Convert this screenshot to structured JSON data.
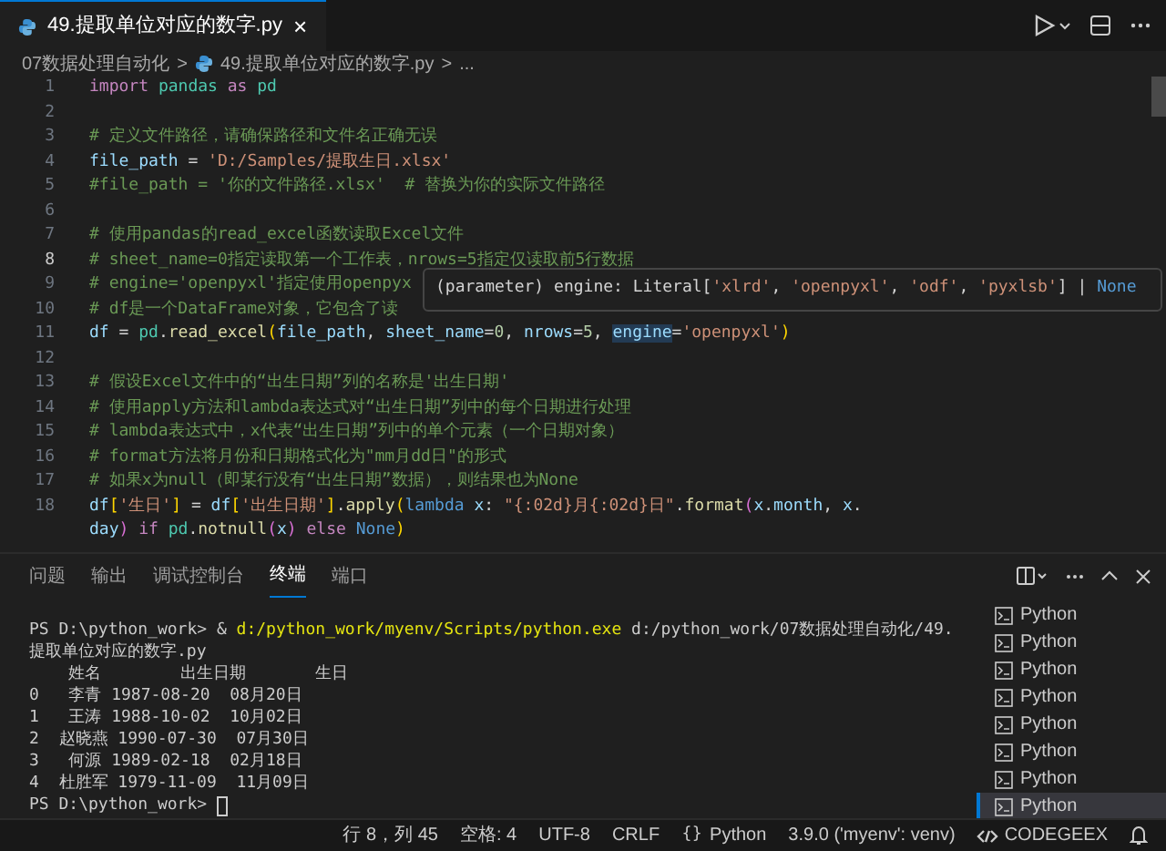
{
  "tab": {
    "label": "49.提取单位对应的数字.py",
    "close": "×",
    "selected": true
  },
  "breadcrumbs": [
    {
      "kind": "folder",
      "text": "07数据处理自动化"
    },
    {
      "kind": "sep",
      "text": ">"
    },
    {
      "kind": "file",
      "text": "49.提取单位对应的数字.py"
    },
    {
      "kind": "sep",
      "text": ">"
    },
    {
      "kind": "more",
      "text": "..."
    }
  ],
  "editor": {
    "rows": [
      {
        "number": "1",
        "active": false,
        "tokens": [
          {
            "kind": "kw",
            "text": "import "
          },
          {
            "kind": "mod",
            "text": "pandas "
          },
          {
            "kind": "kw",
            "text": "as "
          },
          {
            "kind": "mod",
            "text": "pd"
          }
        ]
      },
      {
        "number": "2",
        "active": false,
        "tokens": []
      },
      {
        "number": "3",
        "active": false,
        "tokens": [
          {
            "kind": "cmt",
            "text": "# 定义文件路径，请确保路径和文件名正确无误"
          }
        ]
      },
      {
        "number": "4",
        "active": false,
        "tokens": [
          {
            "kind": "var",
            "text": "file_path"
          },
          {
            "kind": "p",
            "text": " = "
          },
          {
            "kind": "str",
            "text": "'D:/Samples/提取生日.xlsx'"
          }
        ]
      },
      {
        "number": "5",
        "active": false,
        "tokens": [
          {
            "kind": "cmt",
            "text": "#file_path = '你的文件路径.xlsx'  # 替换为你的实际文件路径"
          }
        ]
      },
      {
        "number": "6",
        "active": false,
        "tokens": []
      },
      {
        "number": "7",
        "active": false,
        "tokens": [
          {
            "kind": "cmt",
            "text": "# 使用pandas的read_excel函数读取Excel文件"
          }
        ]
      },
      {
        "number": "8",
        "active": true,
        "tokens": [
          {
            "kind": "cmt",
            "text": "# sheet_name=0指定读取第一个工作表，nrows=5指定仅读取前5行数据"
          }
        ]
      },
      {
        "number": "9",
        "active": false,
        "tokens": [
          {
            "kind": "cmt",
            "text": "# engine='openpyxl'指定使用openpyx"
          }
        ]
      },
      {
        "number": "10",
        "active": false,
        "tokens": [
          {
            "kind": "cmt",
            "text": "# df是一个DataFrame对象，它包含了读"
          }
        ]
      },
      {
        "number": "11",
        "active": false,
        "tokens": [
          {
            "kind": "var",
            "text": "df"
          },
          {
            "kind": "p",
            "text": " = "
          },
          {
            "kind": "mod",
            "text": "pd"
          },
          {
            "kind": "p",
            "text": "."
          },
          {
            "kind": "fn",
            "text": "read_excel"
          },
          {
            "kind": "br",
            "text": "("
          },
          {
            "kind": "var",
            "text": "file_path"
          },
          {
            "kind": "p",
            "text": ", "
          },
          {
            "kind": "var",
            "text": "sheet_name"
          },
          {
            "kind": "p",
            "text": "="
          },
          {
            "kind": "num",
            "text": "0"
          },
          {
            "kind": "p",
            "text": ", "
          },
          {
            "kind": "var",
            "text": "nrows"
          },
          {
            "kind": "p",
            "text": "="
          },
          {
            "kind": "num",
            "text": "5"
          },
          {
            "kind": "p",
            "text": ", "
          },
          {
            "kind": "hl",
            "text": "engine"
          },
          {
            "kind": "p",
            "text": "="
          },
          {
            "kind": "str",
            "text": "'openpyxl'"
          },
          {
            "kind": "br",
            "text": ")"
          }
        ]
      },
      {
        "number": "12",
        "active": false,
        "tokens": []
      },
      {
        "number": "13",
        "active": false,
        "tokens": [
          {
            "kind": "cmt",
            "text": "# 假设Excel文件中的“出生日期”列的名称是'出生日期'"
          }
        ]
      },
      {
        "number": "14",
        "active": false,
        "tokens": [
          {
            "kind": "cmt",
            "text": "# 使用apply方法和lambda表达式对“出生日期”列中的每个日期进行处理"
          }
        ]
      },
      {
        "number": "15",
        "active": false,
        "tokens": [
          {
            "kind": "cmt",
            "text": "# lambda表达式中，x代表“出生日期”列中的单个元素（一个日期对象）"
          }
        ]
      },
      {
        "number": "16",
        "active": false,
        "tokens": [
          {
            "kind": "cmt",
            "text": "# format方法将月份和日期格式化为\"mm月dd日\"的形式"
          }
        ]
      },
      {
        "number": "17",
        "active": false,
        "tokens": [
          {
            "kind": "cmt",
            "text": "# 如果x为null（即某行没有“出生日期”数据），则结果也为None"
          }
        ]
      },
      {
        "number": "18",
        "active": false,
        "tokens": [
          {
            "kind": "var",
            "text": "df"
          },
          {
            "kind": "br",
            "text": "["
          },
          {
            "kind": "str",
            "text": "'生日'"
          },
          {
            "kind": "br",
            "text": "]"
          },
          {
            "kind": "p",
            "text": " = "
          },
          {
            "kind": "var",
            "text": "df"
          },
          {
            "kind": "br",
            "text": "["
          },
          {
            "kind": "str",
            "text": "'出生日期'"
          },
          {
            "kind": "br",
            "text": "]"
          },
          {
            "kind": "p",
            "text": "."
          },
          {
            "kind": "fn",
            "text": "apply"
          },
          {
            "kind": "br",
            "text": "("
          },
          {
            "kind": "stor",
            "text": "lambda "
          },
          {
            "kind": "var",
            "text": "x"
          },
          {
            "kind": "p",
            "text": ": "
          },
          {
            "kind": "str",
            "text": "\"{:02d}月{:02d}日\""
          },
          {
            "kind": "p",
            "text": "."
          },
          {
            "kind": "fn",
            "text": "format"
          },
          {
            "kind": "br2",
            "text": "("
          },
          {
            "kind": "var",
            "text": "x"
          },
          {
            "kind": "p",
            "text": "."
          },
          {
            "kind": "var",
            "text": "month"
          },
          {
            "kind": "p",
            "text": ", "
          },
          {
            "kind": "var",
            "text": "x"
          },
          {
            "kind": "p",
            "text": "."
          }
        ]
      },
      {
        "tokens": [
          {
            "kind": "var",
            "text": "day"
          },
          {
            "kind": "br2",
            "text": ") "
          },
          {
            "kind": "kw",
            "text": "if "
          },
          {
            "kind": "mod",
            "text": "pd"
          },
          {
            "kind": "p",
            "text": "."
          },
          {
            "kind": "fn",
            "text": "notnull"
          },
          {
            "kind": "br2",
            "text": "("
          },
          {
            "kind": "var",
            "text": "x"
          },
          {
            "kind": "br2",
            "text": ") "
          },
          {
            "kind": "kw",
            "text": "else "
          },
          {
            "kind": "stor",
            "text": "None"
          },
          {
            "kind": "br",
            "text": ")"
          }
        ]
      }
    ]
  },
  "hover": {
    "tokens": [
      {
        "kind": "p",
        "text": "(parameter) engine: Literal["
      },
      {
        "kind": "str",
        "text": "'xlrd'"
      },
      {
        "kind": "p",
        "text": ", "
      },
      {
        "kind": "str",
        "text": "'openpyxl'"
      },
      {
        "kind": "p",
        "text": ", "
      },
      {
        "kind": "str",
        "text": "'odf'"
      },
      {
        "kind": "p",
        "text": ", "
      },
      {
        "kind": "str",
        "text": "'pyxlsb'"
      },
      {
        "kind": "p",
        "text": "] | "
      },
      {
        "kind": "stor",
        "text": "None"
      }
    ]
  },
  "panel": {
    "tabs": [
      {
        "label": "问题",
        "selected": false
      },
      {
        "label": "输出",
        "selected": false
      },
      {
        "label": "调试控制台",
        "selected": false
      },
      {
        "label": "终端",
        "selected": true
      },
      {
        "label": "端口",
        "selected": false
      }
    ],
    "terminal_lines": [
      [
        {
          "kind": "plain",
          "text": "PS D:\\python_work> & "
        },
        {
          "kind": "cmd",
          "text": "d:/python_work/myenv/Scripts/python.exe"
        },
        {
          "kind": "plain",
          "text": " d:/python_work/07数据处理自动化/49."
        }
      ],
      [
        {
          "kind": "plain",
          "text": "提取单位对应的数字.py"
        }
      ],
      [
        {
          "kind": "plain",
          "text": "    姓名        出生日期       生日"
        }
      ],
      [
        {
          "kind": "plain",
          "text": "0   李青 1987-08-20  08月20日"
        }
      ],
      [
        {
          "kind": "plain",
          "text": "1   王涛 1988-10-02  10月02日"
        }
      ],
      [
        {
          "kind": "plain",
          "text": "2  赵晓燕 1990-07-30  07月30日"
        }
      ],
      [
        {
          "kind": "plain",
          "text": "3   何源 1989-02-18  02月18日"
        }
      ],
      [
        {
          "kind": "plain",
          "text": "4  杜胜军 1979-11-09  11月09日"
        }
      ],
      [
        {
          "kind": "plain",
          "text": "PS D:\\python_work> "
        },
        {
          "kind": "cursor"
        }
      ]
    ],
    "terminals": [
      {
        "label": "Python",
        "selected": false
      },
      {
        "label": "Python",
        "selected": false
      },
      {
        "label": "Python",
        "selected": false
      },
      {
        "label": "Python",
        "selected": false
      },
      {
        "label": "Python",
        "selected": false
      },
      {
        "label": "Python",
        "selected": false
      },
      {
        "label": "Python",
        "selected": false
      },
      {
        "label": "Python",
        "selected": true
      }
    ]
  },
  "status_bar": {
    "items": [
      {
        "kind": "text",
        "text": "行 8，列 45"
      },
      {
        "kind": "text",
        "text": "空格: 4"
      },
      {
        "kind": "text",
        "text": "UTF-8"
      },
      {
        "kind": "text",
        "text": "CRLF"
      },
      {
        "kind": "lang",
        "icon": "{}",
        "text": "Python"
      },
      {
        "kind": "text",
        "text": "3.9.0 ('myenv': venv)"
      },
      {
        "kind": "brand",
        "text": "CODEGEEX"
      },
      {
        "kind": "bell"
      }
    ]
  }
}
